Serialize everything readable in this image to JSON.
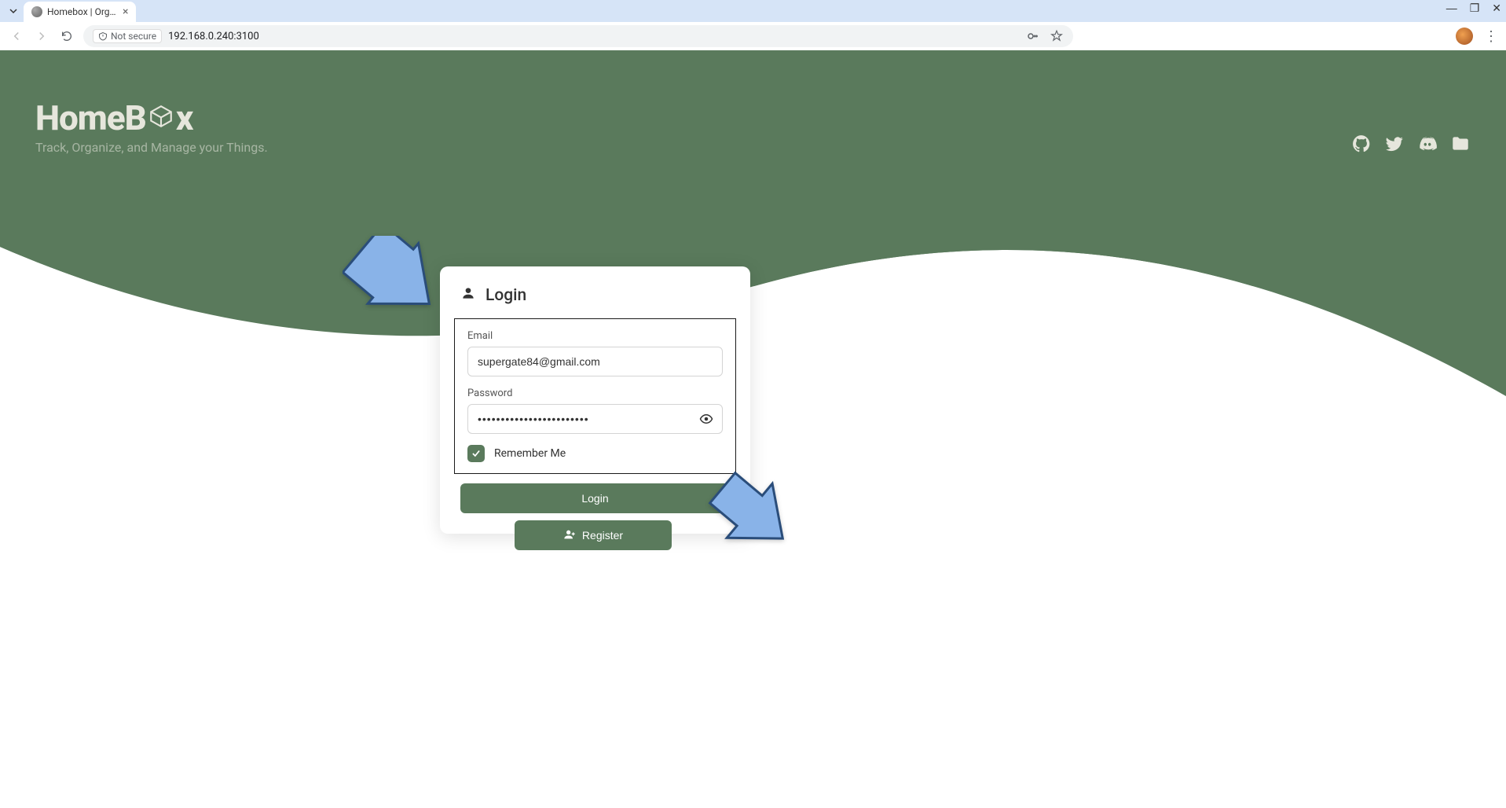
{
  "browser": {
    "tab_title": "Homebox | Organ",
    "url": "192.168.0.240:3100",
    "security_label": "Not secure"
  },
  "brand": {
    "name_pre": "HomeB",
    "name_post": "x",
    "tagline": "Track, Organize, and Manage your Things."
  },
  "login": {
    "title": "Login",
    "email_label": "Email",
    "email_value": "supergate84@gmail.com",
    "password_label": "Password",
    "password_value": "••••••••••••••••••••••••",
    "remember_label": "Remember Me",
    "remember_checked": true,
    "submit_label": "Login"
  },
  "register": {
    "label": "Register"
  },
  "colors": {
    "primary": "#5a7a5c",
    "cream": "#e6e6dc"
  }
}
